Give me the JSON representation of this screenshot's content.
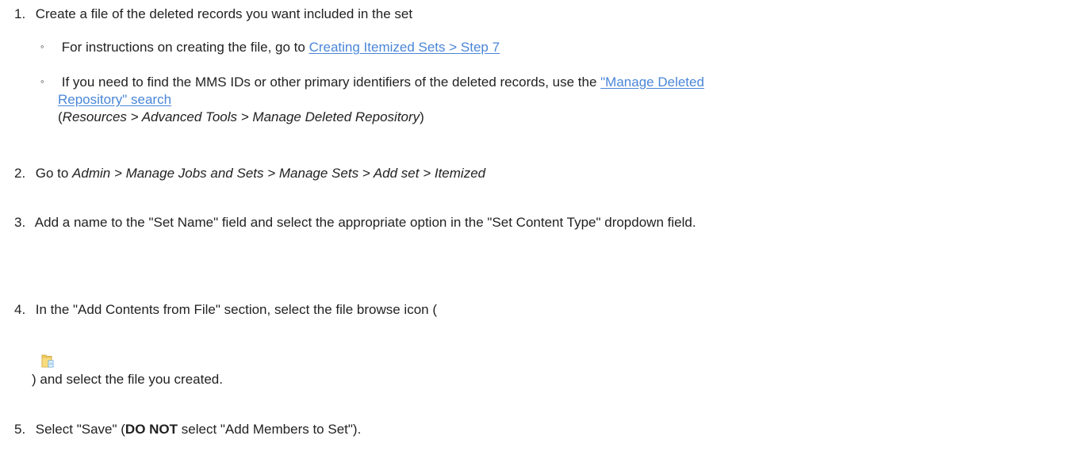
{
  "steps": {
    "s1": {
      "number": "1.",
      "text": "Create a file of the deleted records you want included in the set",
      "bullets": [
        {
          "marker": "◦",
          "prefix": "For instructions on creating the file, go to ",
          "link": "Creating Itemized Sets > Step 7 "
        },
        {
          "marker": "◦",
          "prefix": "If you need to find the MMS IDs or other primary identifiers of the deleted records, use the ",
          "link_line1": "\"Manage Deleted",
          "link_line2": "Repository\" search",
          "path_open": "(",
          "path_p1": "Resources",
          "path_sep1": " > ",
          "path_p2": "Advanced Tools",
          "path_sep2": " > ",
          "path_p3": "Manage Deleted Repository",
          "path_close": ")"
        }
      ]
    },
    "s2": {
      "number": "2.",
      "prefix": "Go to ",
      "p1": "Admin",
      "sep1": " > ",
      "p2": "Manage Jobs and Sets",
      "sep2": " > ",
      "p3": "Manage Sets",
      "sep3": " > ",
      "p4": "Add set",
      "sep4": " > ",
      "p5": "Itemized"
    },
    "s3": {
      "number": "3.",
      "text": "Add a name to the \"Set Name\" field and select the appropriate option in the \"Set Content Type\" dropdown field."
    },
    "s4": {
      "number": "4.",
      "text_line1": "In the \"Add Contents from File\" section, select the file browse icon (",
      "icon": "folder-icon",
      "text_line2": ") and select the file you created."
    },
    "s5": {
      "number": "5.",
      "prefix": "Select \"Save\" (",
      "bold": "DO NOT",
      "suffix": " select \"Add Members to Set\")."
    }
  },
  "colors": {
    "link": "#4a86d8",
    "text": "#222222",
    "folder_fill": "#f3cd5c",
    "folder_accent": "#4aa0e0"
  }
}
